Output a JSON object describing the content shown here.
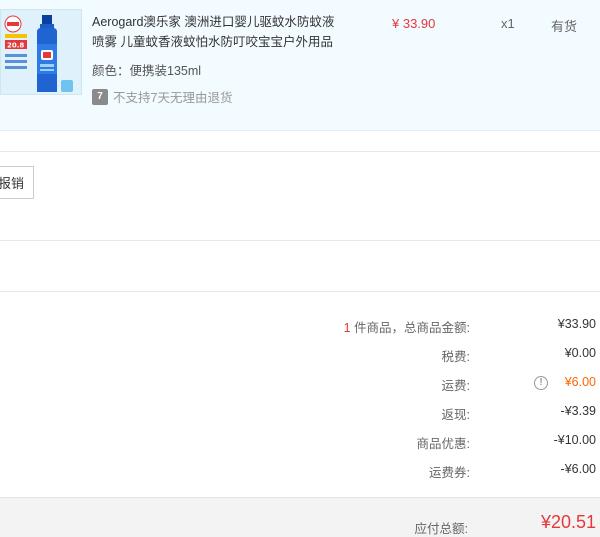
{
  "product": {
    "title": "Aerogard澳乐家 澳洲进口婴儿驱蚊水防蚊液喷雾 儿童蚊香液蚊怕水防叮咬宝宝户外用品",
    "spec_label": "颜色：",
    "spec_value": "便携装135ml",
    "no_return_icon": "7",
    "no_return_text": "不支持7天无理由退货",
    "price": "¥ 33.90",
    "quantity": "x1",
    "stock": "有货",
    "thumb_icon": "product-bottle-image"
  },
  "actions": {
    "reimburse_label": "报销"
  },
  "summary": {
    "count": "1",
    "count_label": " 件商品，总商品金额:",
    "goods_amount": "¥33.90",
    "tax_label": "税费:",
    "tax_value": "¥0.00",
    "shipping_label": "运费:",
    "shipping_info_icon": "!",
    "shipping_value": "¥6.00",
    "cashback_label": "返现:",
    "cashback_value": "-¥3.39",
    "discount_label": "商品优惠:",
    "discount_value": "-¥10.00",
    "shipping_coupon_label": "运费券:",
    "shipping_coupon_value": "-¥6.00",
    "total_label": "应付总额:",
    "total_value": "¥20.51"
  },
  "colors": {
    "accent_red": "#e4393c",
    "accent_orange": "#ff6600",
    "card_bg": "#f2fbff"
  }
}
